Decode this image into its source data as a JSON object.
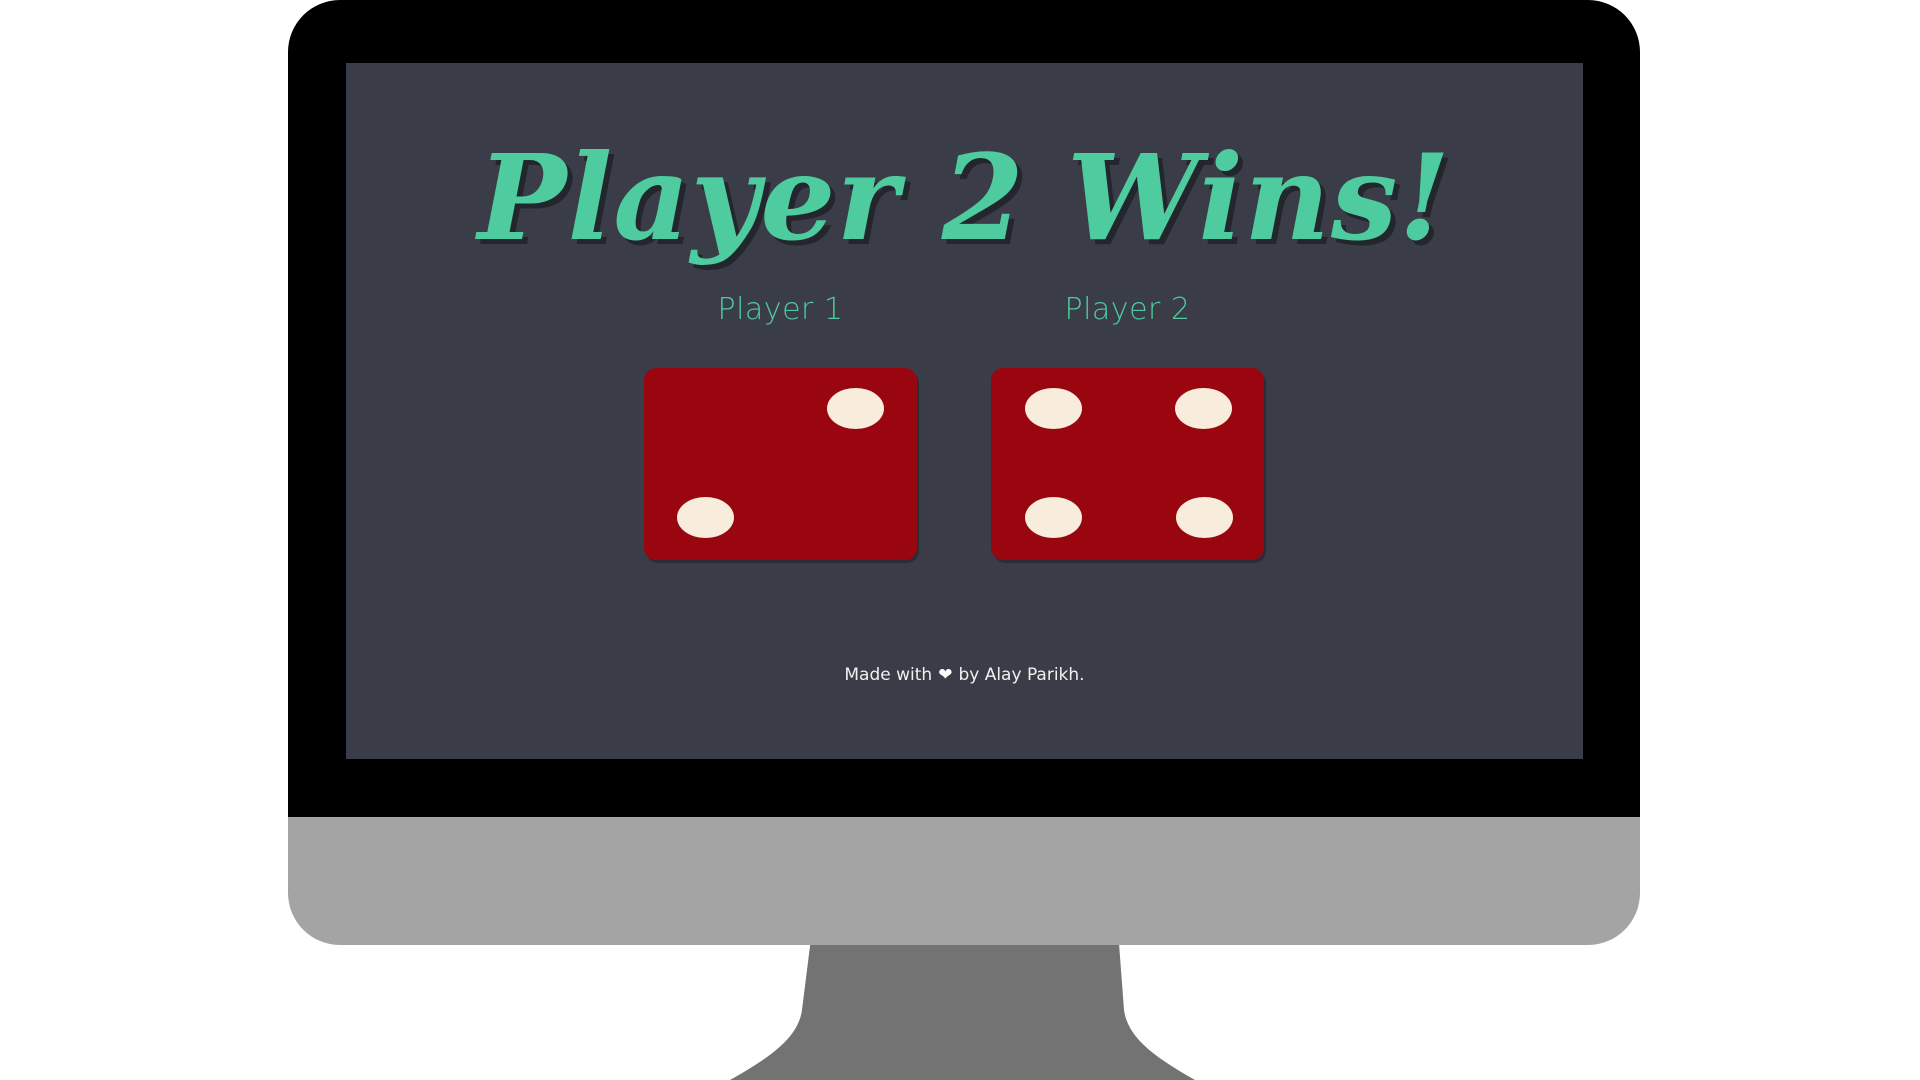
{
  "game": {
    "result_title": "Player 2 Wins!",
    "players": [
      {
        "label": "Player 1",
        "die_value": 2
      },
      {
        "label": "Player 2",
        "die_value": 4
      }
    ]
  },
  "footer": {
    "prefix": "Made with",
    "heart_icon": "heart-icon",
    "heart_glyph": "❤",
    "suffix": "by Alay Parikh."
  },
  "colors": {
    "screen_bg": "#3a3d47",
    "accent": "#4ecc9f",
    "die": "#9a060f",
    "pip": "#f8eddc",
    "bezel": "#000000",
    "chin": "#a4a4a4",
    "stand": "#737373"
  }
}
